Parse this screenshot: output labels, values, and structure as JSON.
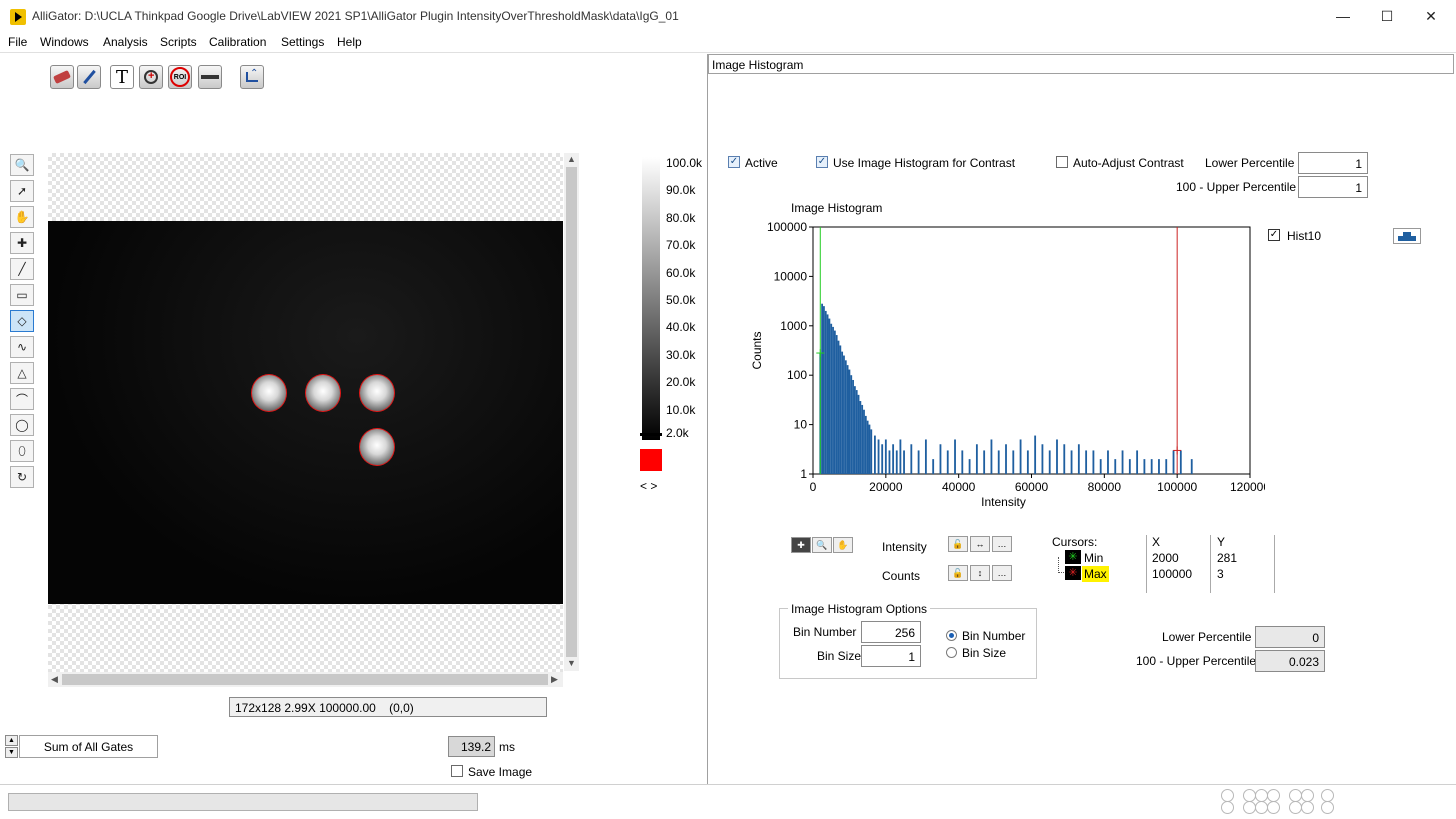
{
  "window": {
    "title": "AlliGator: D:\\UCLA Thinkpad Google Drive\\LabVIEW 2021 SP1\\AlliGator Plugin IntensityOverThresholdMask\\data\\IgG_01"
  },
  "menu": [
    "File",
    "Windows",
    "Analysis",
    "Scripts",
    "Calibration",
    "Settings",
    "Help"
  ],
  "toolbar": {
    "text_tool_glyph": "T",
    "roi_label": "ROI"
  },
  "image_panel": {
    "colorbar_labels": [
      "100.0k",
      "90.0k",
      "80.0k",
      "70.0k",
      "60.0k",
      "50.0k",
      "40.0k",
      "30.0k",
      "20.0k",
      "10.0k",
      "2.0k"
    ],
    "colormap_arrows": "< >",
    "status": "172x128 2.99X 100000.00    (0,0)",
    "gate_selector": "Sum of All Gates",
    "exposure_value": "139.2",
    "exposure_unit": "ms",
    "save_image_label": "Save Image"
  },
  "histogram_panel": {
    "header": "Image Histogram",
    "active_label": "Active",
    "use_histogram_label": "Use Image Histogram for Contrast",
    "auto_adjust_label": "Auto-Adjust Contrast",
    "lower_percentile_label": "Lower Percentile",
    "lower_percentile_value": "1",
    "upper_percentile_label": "100 - Upper Percentile",
    "upper_percentile_value": "1",
    "plot_title": "Image Histogram",
    "legend_label": "Hist10",
    "intensity_label": "Intensity",
    "counts_label": "Counts",
    "cursors": {
      "title": "Cursors:",
      "x_header": "X",
      "y_header": "Y",
      "rows": [
        {
          "name": "Min",
          "x": "2000",
          "y": "281"
        },
        {
          "name": "Max",
          "x": "100000",
          "y": "3"
        }
      ]
    },
    "options": {
      "title": "Image Histogram Options",
      "bin_number_label": "Bin Number",
      "bin_number_value": "256",
      "bin_size_label": "Bin Size",
      "bin_size_value": "1",
      "radio_bin_number": "Bin Number",
      "radio_bin_size": "Bin Size"
    },
    "result_lower_label": "Lower Percentile",
    "result_lower_value": "0",
    "result_upper_label": "100 - Upper Percentile",
    "result_upper_value": "0.023"
  },
  "chart_data": {
    "type": "bar",
    "title": "Image Histogram",
    "xlabel": "Intensity",
    "ylabel": "Counts",
    "xlim": [
      0,
      120000
    ],
    "ylim": [
      1,
      100000
    ],
    "y_scale": "log",
    "x_ticks": [
      "0",
      "20000",
      "40000",
      "60000",
      "80000",
      "100000",
      "120000"
    ],
    "y_ticks": [
      "1",
      "10",
      "100",
      "1000",
      "10000",
      "100000"
    ],
    "series": [
      {
        "name": "Hist10",
        "color": "#1f5fa0",
        "x": [
          2000,
          2500,
          3000,
          3500,
          4000,
          4500,
          5000,
          5500,
          6000,
          6500,
          7000,
          7500,
          8000,
          8500,
          9000,
          9500,
          10000,
          10500,
          11000,
          11500,
          12000,
          12500,
          13000,
          13500,
          14000,
          14500,
          15000,
          15500,
          16000,
          17000,
          18000,
          19000,
          20000,
          21000,
          22000,
          23000,
          24000,
          25000,
          27000,
          29000,
          31000,
          33000,
          35000,
          37000,
          39000,
          41000,
          43000,
          45000,
          47000,
          49000,
          51000,
          53000,
          55000,
          57000,
          59000,
          61000,
          63000,
          65000,
          67000,
          69000,
          71000,
          73000,
          75000,
          77000,
          79000,
          81000,
          83000,
          85000,
          87000,
          89000,
          91000,
          93000,
          95000,
          97000,
          99000,
          101000,
          104000,
          107000,
          110000,
          113000,
          116000
        ],
        "values": [
          281,
          2800,
          2500,
          2000,
          1700,
          1400,
          1100,
          950,
          800,
          650,
          500,
          400,
          300,
          250,
          200,
          160,
          130,
          100,
          80,
          60,
          50,
          40,
          30,
          25,
          20,
          15,
          12,
          10,
          8,
          6,
          5,
          4,
          5,
          3,
          4,
          3,
          5,
          3,
          4,
          3,
          5,
          2,
          4,
          3,
          5,
          3,
          2,
          4,
          3,
          5,
          3,
          4,
          3,
          5,
          3,
          6,
          4,
          3,
          5,
          4,
          3,
          4,
          3,
          3,
          2,
          3,
          2,
          3,
          2,
          3,
          2,
          2,
          2,
          2,
          3,
          3,
          2,
          1,
          1,
          1,
          1
        ]
      }
    ],
    "cursors": [
      {
        "name": "Min",
        "x": 2000,
        "y": 281,
        "color": "#22cc22"
      },
      {
        "name": "Max",
        "x": 100000,
        "y": 3,
        "color": "#cc2222"
      }
    ],
    "grid": false,
    "legend": "top-right"
  }
}
